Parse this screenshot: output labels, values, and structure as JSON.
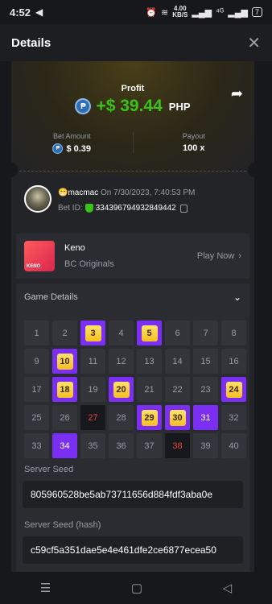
{
  "status_bar": {
    "time": "4:52",
    "speed": "4.00",
    "speed_unit": "KB/S",
    "network": "⁴ᴳ",
    "battery": "7"
  },
  "header": {
    "title": "Details",
    "close_label": "✕"
  },
  "profit": {
    "label": "Profit",
    "coin": "₱",
    "value": "+$ 39.44",
    "currency": "PHP",
    "accent": "#3bc117"
  },
  "bet": {
    "amount_label": "Bet Amount",
    "amount_value": "$ 0.39",
    "payout_label": "Payout",
    "payout_value": "100 x"
  },
  "user": {
    "name": "😁macmac",
    "date": "On 7/30/2023, 7:40:53 PM",
    "bet_id_label": "Bet ID:",
    "bet_id": "334396794932849442"
  },
  "game": {
    "name": "Keno",
    "provider": "BC Originals",
    "logo_text": "KENO",
    "play_label": "Play Now"
  },
  "game_details": {
    "title": "Game Details",
    "grid": [
      {
        "n": "1",
        "s": ""
      },
      {
        "n": "2",
        "s": ""
      },
      {
        "n": "3",
        "s": "hit"
      },
      {
        "n": "4",
        "s": ""
      },
      {
        "n": "5",
        "s": "hit"
      },
      {
        "n": "6",
        "s": ""
      },
      {
        "n": "7",
        "s": ""
      },
      {
        "n": "8",
        "s": ""
      },
      {
        "n": "9",
        "s": ""
      },
      {
        "n": "10",
        "s": "hit"
      },
      {
        "n": "11",
        "s": ""
      },
      {
        "n": "12",
        "s": ""
      },
      {
        "n": "13",
        "s": ""
      },
      {
        "n": "14",
        "s": ""
      },
      {
        "n": "15",
        "s": ""
      },
      {
        "n": "16",
        "s": ""
      },
      {
        "n": "17",
        "s": ""
      },
      {
        "n": "18",
        "s": "hit"
      },
      {
        "n": "19",
        "s": ""
      },
      {
        "n": "20",
        "s": "hit"
      },
      {
        "n": "21",
        "s": ""
      },
      {
        "n": "22",
        "s": ""
      },
      {
        "n": "23",
        "s": ""
      },
      {
        "n": "24",
        "s": "hit"
      },
      {
        "n": "25",
        "s": ""
      },
      {
        "n": "26",
        "s": ""
      },
      {
        "n": "27",
        "s": "drawn"
      },
      {
        "n": "28",
        "s": ""
      },
      {
        "n": "29",
        "s": "hit"
      },
      {
        "n": "30",
        "s": "hit"
      },
      {
        "n": "31",
        "s": "pick"
      },
      {
        "n": "32",
        "s": ""
      },
      {
        "n": "33",
        "s": ""
      },
      {
        "n": "34",
        "s": "pick"
      },
      {
        "n": "35",
        "s": ""
      },
      {
        "n": "36",
        "s": ""
      },
      {
        "n": "37",
        "s": ""
      },
      {
        "n": "38",
        "s": "drawn"
      },
      {
        "n": "39",
        "s": ""
      },
      {
        "n": "40",
        "s": ""
      }
    ],
    "server_seed_label": "Server Seed",
    "server_seed": "805960528be5ab73711656d884fdf3aba0e",
    "server_seed_hash_label": "Server Seed (hash)",
    "server_seed_hash": "c59cf5a351dae5e4e461dfe2ce6877ecea50"
  },
  "nav": {
    "menu": "☰",
    "home": "▢",
    "back": "◁"
  }
}
